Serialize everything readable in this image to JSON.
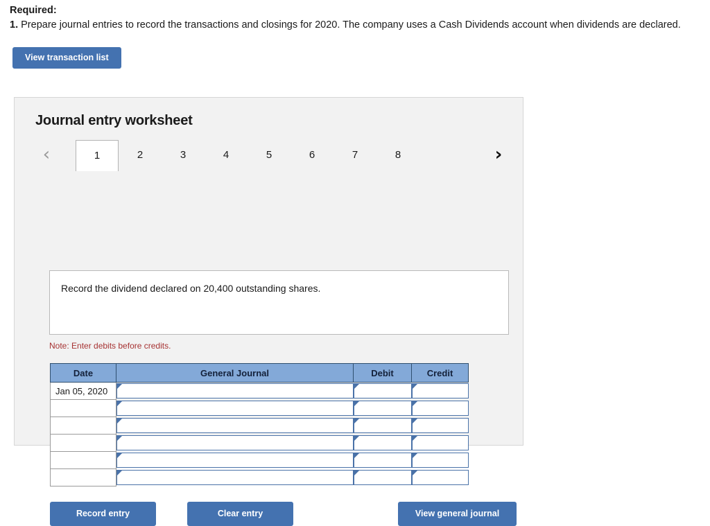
{
  "required": {
    "heading": "Required:",
    "item_number": "1.",
    "item_text": "Prepare journal entries to record the transactions and closings for 2020. The company uses a Cash Dividends account when dividends are declared."
  },
  "toolbar": {
    "view_transaction_list_label": "View transaction list"
  },
  "worksheet": {
    "title": "Journal entry worksheet",
    "nav": {
      "prev_icon": "chevron-left-icon",
      "next_icon": "chevron-right-icon",
      "prev_glyph": "‹",
      "next_glyph": "›"
    },
    "tabs": [
      {
        "label": "1",
        "active": true
      },
      {
        "label": "2",
        "active": false
      },
      {
        "label": "3",
        "active": false
      },
      {
        "label": "4",
        "active": false
      },
      {
        "label": "5",
        "active": false
      },
      {
        "label": "6",
        "active": false
      },
      {
        "label": "7",
        "active": false
      },
      {
        "label": "8",
        "active": false
      }
    ],
    "prompt": "Record the dividend declared on 20,400 outstanding shares.",
    "note": "Note: Enter debits before credits.",
    "table": {
      "headers": [
        "Date",
        "General Journal",
        "Debit",
        "Credit"
      ],
      "rows": [
        {
          "date": "Jan 05, 2020",
          "general_journal": "",
          "debit": "",
          "credit": ""
        },
        {
          "date": "",
          "general_journal": "",
          "debit": "",
          "credit": ""
        },
        {
          "date": "",
          "general_journal": "",
          "debit": "",
          "credit": ""
        },
        {
          "date": "",
          "general_journal": "",
          "debit": "",
          "credit": ""
        },
        {
          "date": "",
          "general_journal": "",
          "debit": "",
          "credit": ""
        },
        {
          "date": "",
          "general_journal": "",
          "debit": "",
          "credit": ""
        }
      ]
    },
    "actions": {
      "record_entry_label": "Record entry",
      "clear_entry_label": "Clear entry",
      "view_general_journal_label": "View general journal"
    }
  },
  "colors": {
    "button_blue": "#4472b0",
    "table_header_blue": "#83a9d8",
    "field_border_blue": "#4a72a8",
    "note_red": "#a63232",
    "panel_bg": "#f2f2f2"
  }
}
